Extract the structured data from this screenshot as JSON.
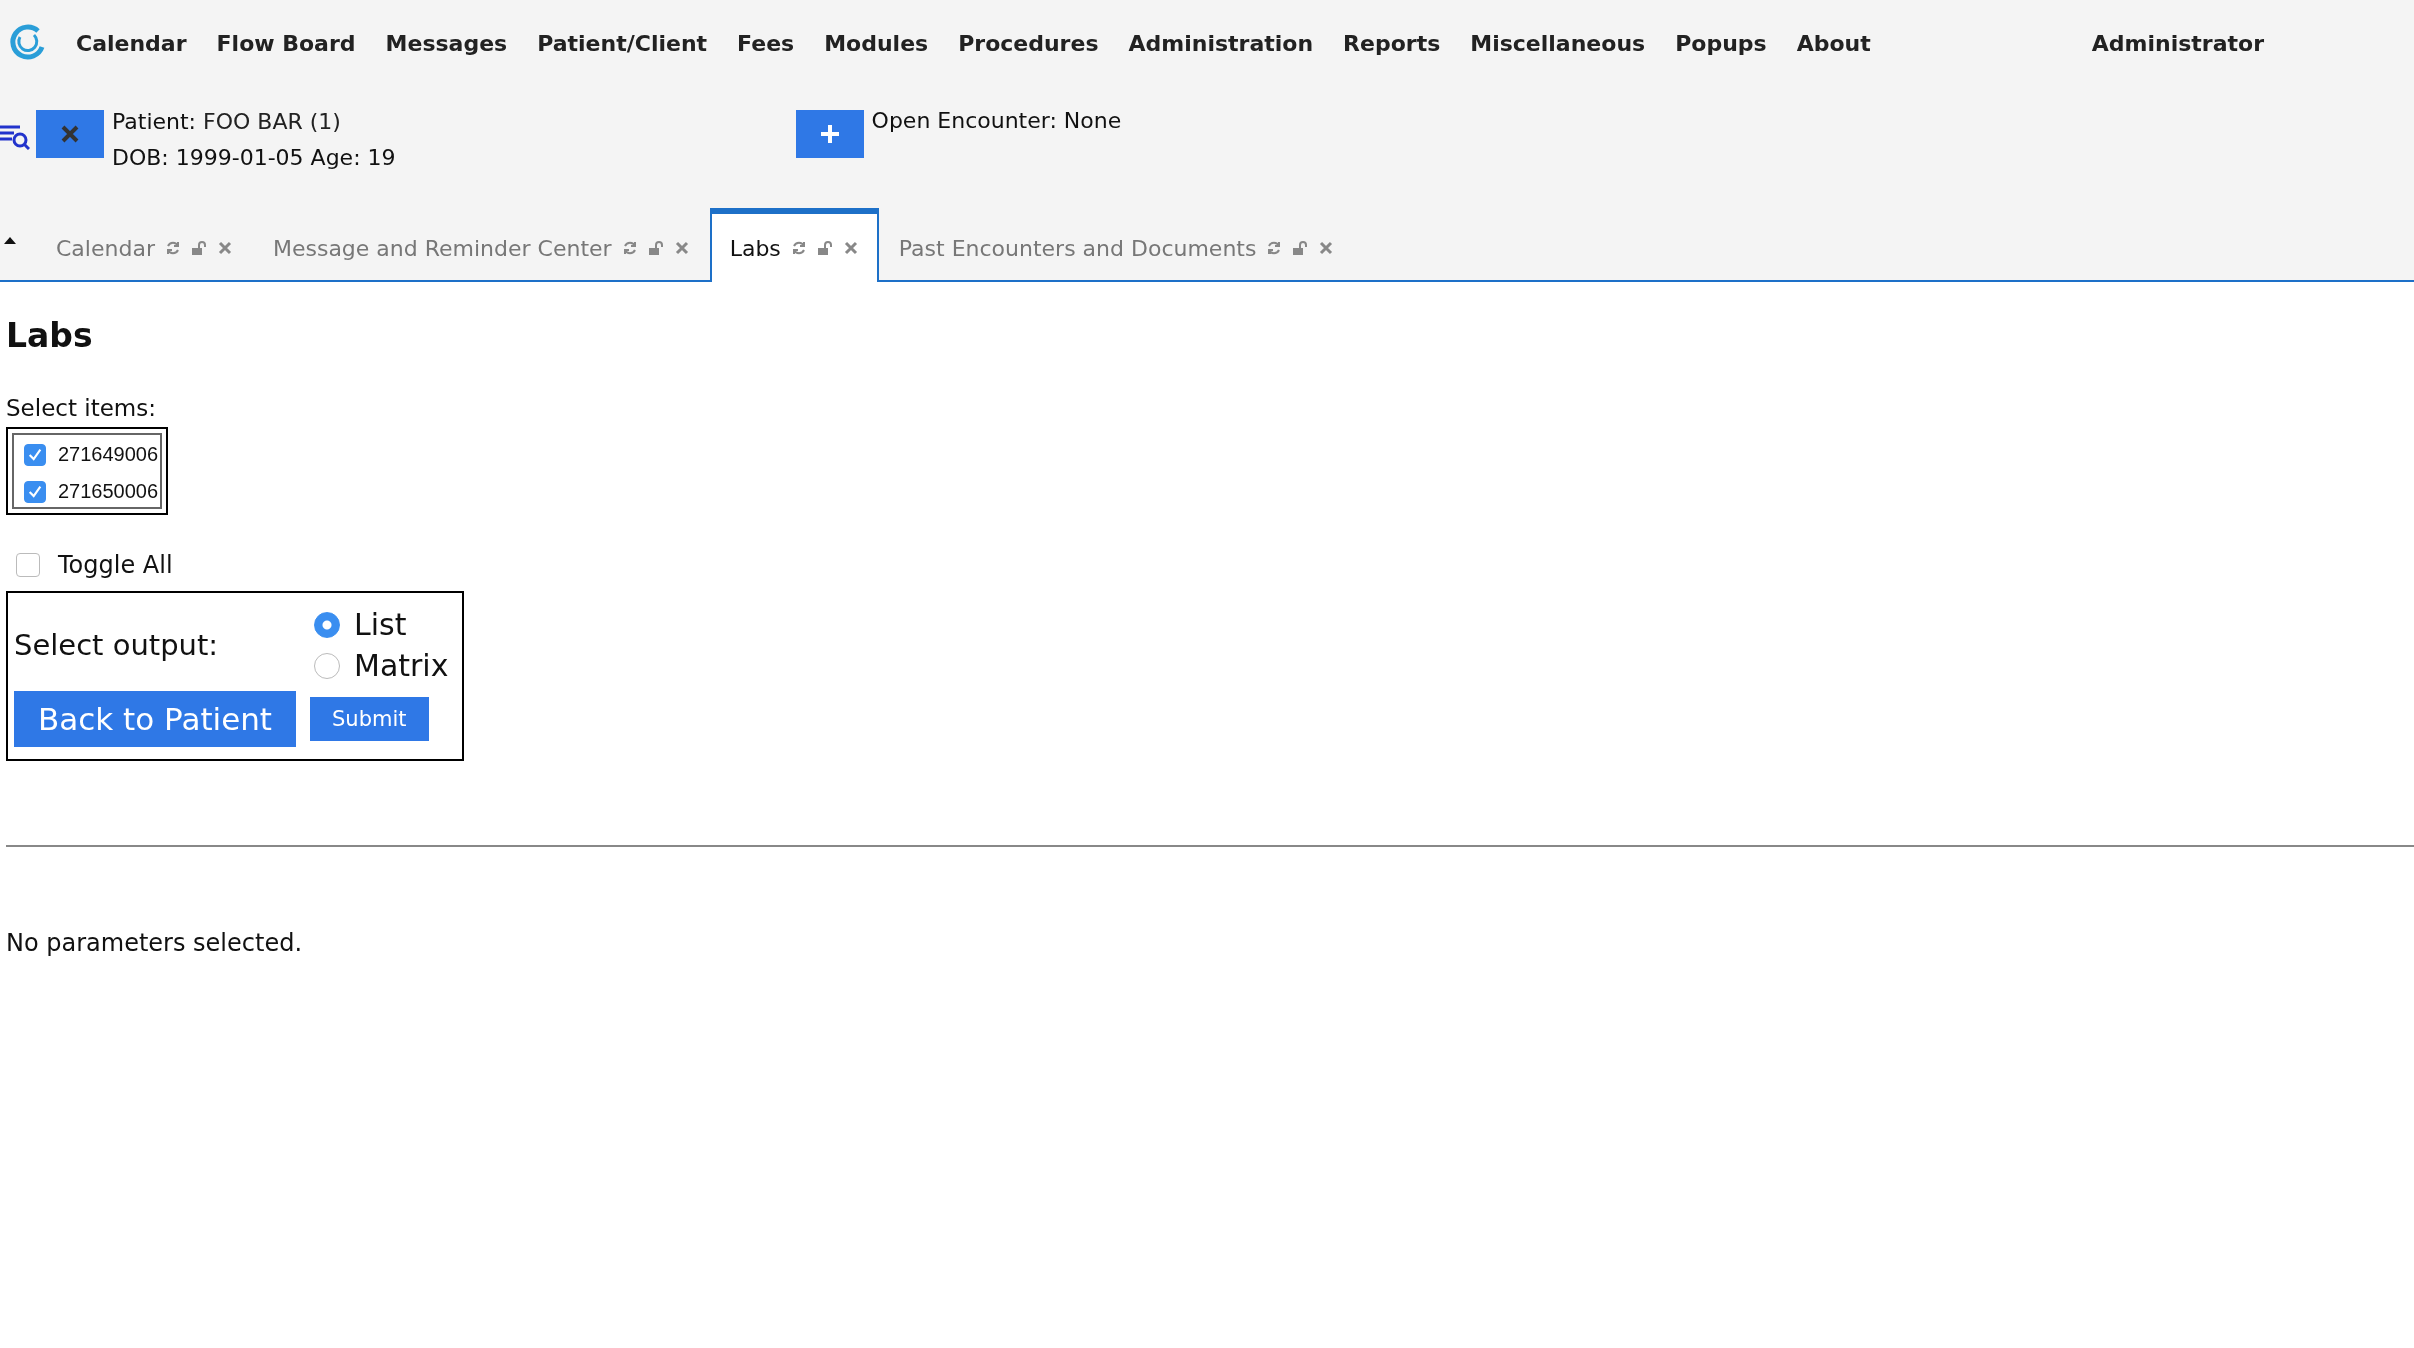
{
  "nav": {
    "items": [
      "Calendar",
      "Flow Board",
      "Messages",
      "Patient/Client",
      "Fees",
      "Modules",
      "Procedures",
      "Administration",
      "Reports",
      "Miscellaneous",
      "Popups",
      "About"
    ],
    "user": "Administrator"
  },
  "patient": {
    "label": "Patient:",
    "name": "FOO BAR (1)",
    "details": "DOB: 1999-01-05 Age: 19"
  },
  "encounter": "Open Encounter: None",
  "tabs": [
    {
      "label": "Calendar",
      "selected": false
    },
    {
      "label": "Message and Reminder Center",
      "selected": false
    },
    {
      "label": "Labs",
      "selected": true
    },
    {
      "label": "Past Encounters and Documents",
      "selected": false
    }
  ],
  "title": "Labs",
  "select_items": {
    "label": "Select items:",
    "items": [
      {
        "label": "271649006",
        "checked": true
      },
      {
        "label": "271650006",
        "checked": true
      }
    ]
  },
  "toggle_all": {
    "label": "Toggle All",
    "checked": false
  },
  "output": {
    "label": "Select output:",
    "options": [
      {
        "label": "List",
        "selected": true
      },
      {
        "label": "Matrix",
        "selected": false
      }
    ]
  },
  "buttons": {
    "back": "Back to Patient",
    "submit": "Submit"
  },
  "message": "No parameters selected."
}
